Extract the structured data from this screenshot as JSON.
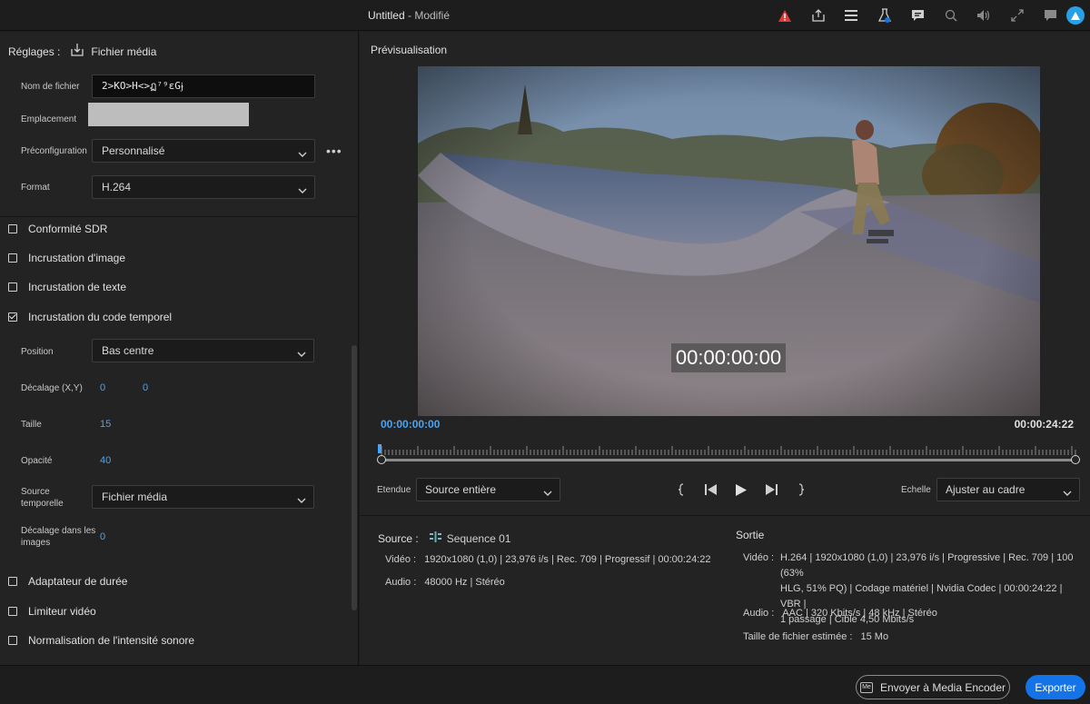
{
  "titlebar": {
    "title": "Untitled",
    "modified": " - Modifié"
  },
  "toolbar_icons": [
    "warning-icon",
    "share-icon",
    "queue-icon",
    "flask-icon",
    "comments-icon",
    "zoom-icon",
    "volume-icon",
    "fullscreen-icon",
    "feedback-icon"
  ],
  "colors": {
    "accent": "#1473e6",
    "timecode_blue": "#4ba3f5",
    "warning": "#e03a3a"
  },
  "settings": {
    "label": "Réglages :",
    "source_label": "Fichier média",
    "filename_label": "Nom de fichier",
    "filename_value": "2>KO>H<>ฏ⁷⁹ɛGɉ",
    "location_label": "Emplacement",
    "preset_label": "Préconfiguration",
    "preset_value": "Personnalisé",
    "more": "•••",
    "format_label": "Format",
    "format_value": "H.264"
  },
  "effects": {
    "sdr": "Conformité SDR",
    "image_overlay": "Incrustation d'image",
    "text_overlay": "Incrustation de texte",
    "timecode_overlay": "Incrustation du code temporel",
    "position_label": "Position",
    "position_value": "Bas centre",
    "offset_label": "Décalage (X,Y)",
    "offset_x": "0",
    "offset_y": "0",
    "size_label": "Taille",
    "size_value": "15",
    "opacity_label": "Opacité",
    "opacity_value": "40",
    "time_source_label_1": "Source",
    "time_source_label_2": "temporelle",
    "time_source_value": "Fichier média",
    "frame_offset_label_1": "Décalage dans les",
    "frame_offset_label_2": "images",
    "frame_offset_value": "0",
    "duration_adapter": "Adaptateur de durée",
    "video_limiter": "Limiteur vidéo",
    "loudness": "Normalisation de l'intensité sonore"
  },
  "preview": {
    "title": "Prévisualisation",
    "overlay_timecode": "00:00:00:00",
    "current_time": "00:00:00:00",
    "duration": "00:00:24:22",
    "range_label": "Etendue",
    "range_value": "Source entière",
    "scale_label": "Echelle",
    "scale_value": "Ajuster au cadre"
  },
  "source_info": {
    "label": "Source :",
    "name": "Sequence 01",
    "video_label": "Vidéo :",
    "video_value": "1920x1080 (1,0)  |  23,976 i/s  |  Rec. 709  |  Progressif  |  00:00:24:22",
    "audio_label": "Audio :",
    "audio_value": "48000 Hz  |  Stéréo"
  },
  "output_info": {
    "label": "Sortie",
    "video_label": "Vidéo :",
    "video_line1": "H.264  |  1920x1080 (1,0)  |  23,976 i/s  |  Progressive  |  Rec. 709  |  100 (63%",
    "video_line2": "HLG, 51% PQ)  |  Codage matériel  |  Nvidia Codec  |  00:00:24:22  |  VBR  |",
    "video_line3": "1 passage  |  Cible 4,50 Mbits/s",
    "audio_label": "Audio :",
    "audio_value": "AAC  |  320 Kbits/s  |  48 kHz  |  Stéréo",
    "size_label": "Taille de fichier estimée :",
    "size_value": "15 Mo"
  },
  "footer": {
    "media_encoder_button": "Envoyer à Media Encoder",
    "export_button": "Exporter"
  }
}
